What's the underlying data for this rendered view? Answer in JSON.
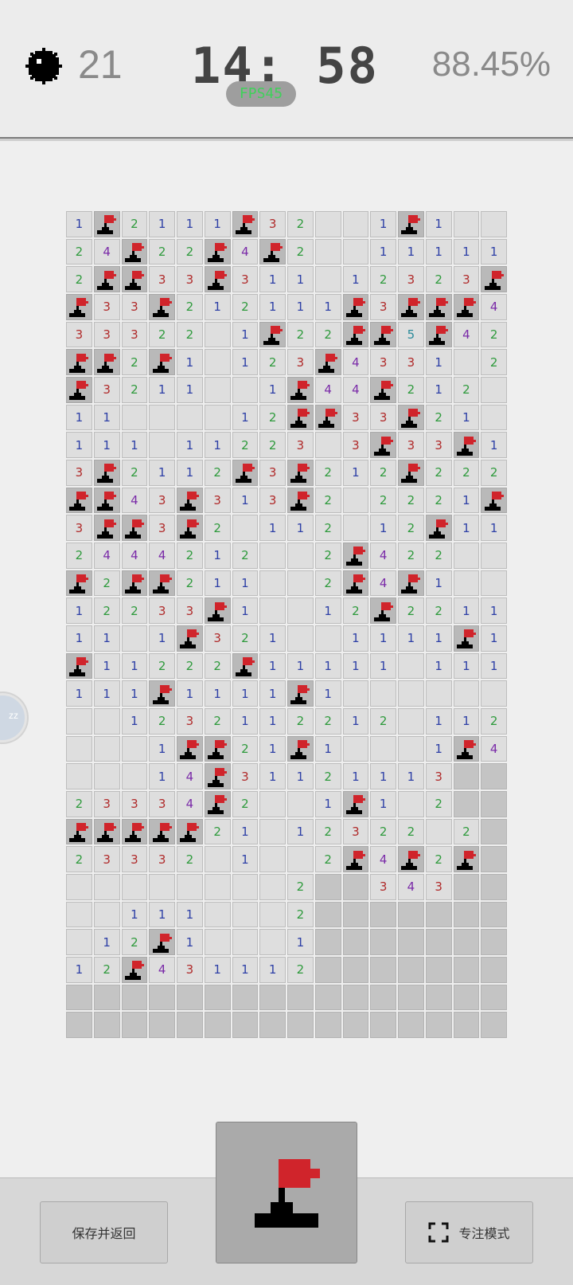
{
  "header": {
    "mine_icon": "mine-icon",
    "mines_remaining": "21",
    "timer": "14: 58",
    "fps": "FPS45",
    "progress_percent": "88.45%"
  },
  "side_handle": {
    "label": "zz"
  },
  "board": {
    "cols": 16,
    "rows": 30,
    "legend": {
      "F": "flag",
      "#": "covered",
      ".": "revealed-empty"
    },
    "grid": [
      "1F2111F32..1F1..",
      "24F22F4F2..11111",
      "2FF33F311.12323F",
      "F33F212111F3FFF4F",
      "33322.1F22FF5F42",
      "FF2F1.123F4331.2F",
      "F3211..1F44F212.1",
      "11....12FF33F21.",
      "111.11223.3F33F1",
      "3F2112F3F212F222",
      "FF43F313F2.2221F",
      "3FF3F2.112.12F111",
      "2444212..2F422..",
      "F2FF211..2F4F1..",
      "12233F1..12F2211",
      "11.1F321..1111F1",
      "F11222F11111.111",
      "111F1111F1......",
      "..1232112212.11221",
      "...1FF21F1...1F4F",
      "...14F31121113##",
      "23334F2..1F1.2##",
      "FFFFF21.12322 2##",
      "23332 1..2F4F2F##",
      "........2##343##",
      "..111...2#######",
      ".12F1...1#######",
      "12F431112#######",
      "################",
      "################"
    ]
  },
  "footer": {
    "save_label": "保存并返回",
    "focus_label": "专注模式",
    "focus_icon": "fullscreen-icon",
    "mode_icon": "flag-icon"
  },
  "colors": {
    "n1": "#2d3fa6",
    "n2": "#2e9a3c",
    "n3": "#b02a2a",
    "n4": "#7a2aa8",
    "n5": "#2a8a9a",
    "flag": "#d0242b",
    "fps": "#3fd15a"
  }
}
